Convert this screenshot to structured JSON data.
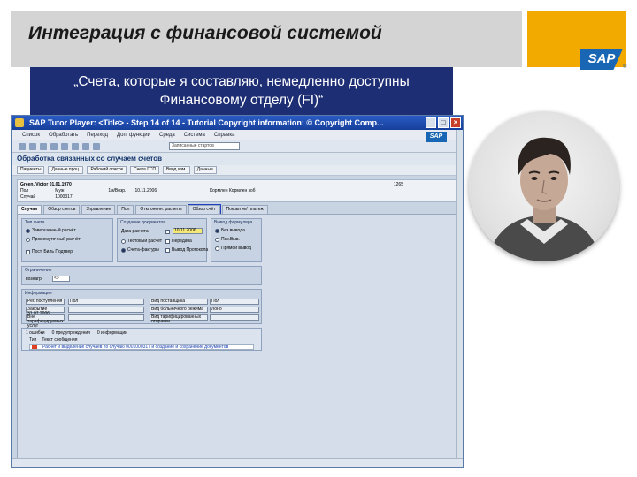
{
  "slide": {
    "title": "Интеграция с финансовой системой",
    "quote": "„Счета, которые я составляю, немедленно доступны Финансовому отделу (FI)“",
    "logo_text": "SAP",
    "colors": {
      "title_bar": "#d4d4d4",
      "accent_orange": "#f2a900",
      "quote_bg": "#1d2e74",
      "sap_blue": "#1866b4"
    }
  },
  "sap_window": {
    "titlebar": "SAP Tutor Player: <Title> - Step 14 of 14 - Tutorial Copyright information: © Copyright Comp...",
    "menu": [
      "Список",
      "Обработать",
      "Переход",
      "Доп. функции",
      "Среда",
      "Система",
      "Справка"
    ],
    "toolbar_field": "Записанные стартов",
    "mini_logo": "SAP",
    "screen_title": "Обработка связанных со случаем счетов",
    "app_buttons": [
      "Пациенты",
      "Данные проц.",
      "Рабочий список",
      "Счета ГСП",
      "Ввод изм.",
      "Данные"
    ],
    "patient": {
      "name": "Green, Victor 01.01.1970",
      "fields_row1": [
        "Пол",
        "Муж",
        "1м/Возр.",
        "10.11.2006",
        "Кормлен Кормлен зоб"
      ],
      "fields_row2": [
        "Случай",
        "1000317"
      ],
      "right_code": "1265"
    },
    "tabs": [
      "Случаи",
      "Обзор счетов",
      "Управление",
      "Пол",
      "Отклоненн. расчеты",
      "Обзор счёт",
      "Покрытие/ платеж"
    ],
    "active_tab_index": 0,
    "highlighted_tab_index": 5,
    "groups": {
      "billing_type": {
        "title": "Тип счета",
        "options": [
          "Завершенный расчёт",
          "Промежуточный расчёт",
          "Пост. Биль Подтвер"
        ],
        "selected": 0
      },
      "create_docs": {
        "title": "Создание документов",
        "date_label": "Дата расчета",
        "date_value": "10.11.2006",
        "options": [
          "Тестовый расчет",
          "Счета-фактуры"
        ],
        "option_right": "Вывод Протокола",
        "check_label": "Передача"
      },
      "print_format": {
        "title": "Вывод формулярa",
        "options": [
          "Без вывода",
          "Пак.Выв.",
          "Прямой вывод"
        ],
        "selected": 0
      },
      "restriction": {
        "title": "Ограничение",
        "field_label": "вознагр.",
        "field_value": "<>"
      },
      "info": {
        "title": "Информация",
        "rows": [
          [
            "Рег. поступления",
            "Пол",
            "Вид поставщика",
            "Пол"
          ],
          [
            "Закрытие 31.07.2006",
            "",
            "Вид больничного режима",
            "Лоно"
          ],
          [
            "Вне тарифицируемых услуг",
            "",
            "Вид тарифицированных отправки",
            ""
          ]
        ]
      },
      "messages": {
        "header": [
          "1 ошибки",
          "0 предупреждения",
          "0 информации"
        ],
        "columns": [
          "Тип",
          "Текст сообщения"
        ],
        "row": "Расчет и выделение случаев по случаю 0001000317 и создание и сохранение документов"
      }
    }
  }
}
